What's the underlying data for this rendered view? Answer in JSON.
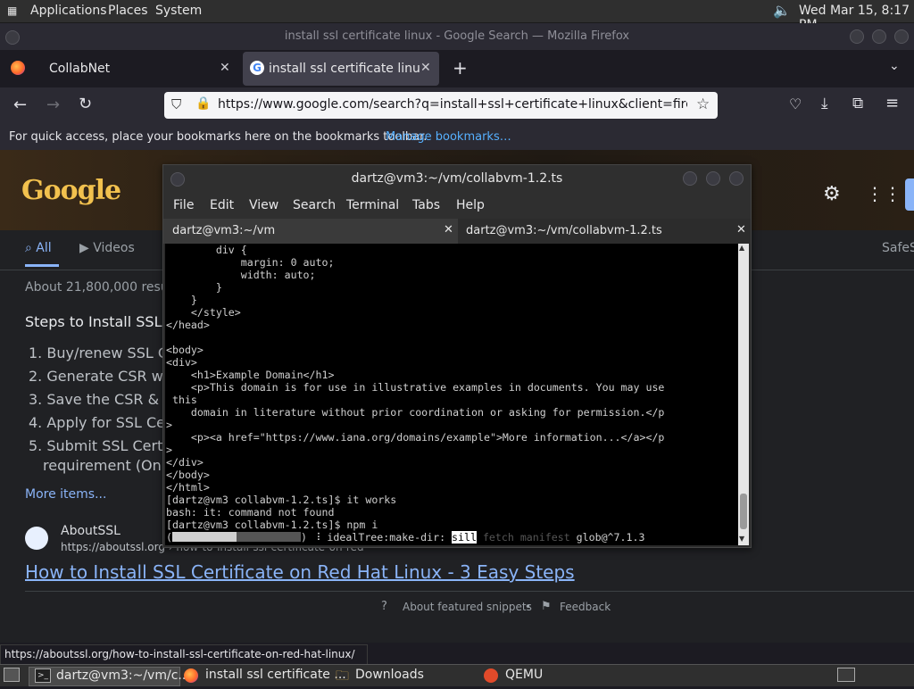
{
  "panel": {
    "applications": "Applications",
    "places": "Places",
    "system": "System",
    "clock": "Wed Mar 15,  8:17 PM"
  },
  "firefox": {
    "window_title": "install ssl certificate linux - Google Search — Mozilla Firefox",
    "tabs": [
      {
        "label": "CollabNet"
      },
      {
        "label": "install ssl certificate linux - Goo"
      }
    ],
    "url": "https://www.google.com/search?q=install+ssl+certificate+linux&client=firefox-b-1-d",
    "bookmarks_text": "For quick access, place your bookmarks here on the bookmarks toolbar.",
    "manage_bookmarks": "Manage bookmarks…"
  },
  "google": {
    "logo": "Google",
    "nav": {
      "all": "All",
      "videos": "Videos",
      "safesearch": "SafeS"
    },
    "result_stats": "About 21,800,000 results",
    "snippet_title": "Steps to Install SSL Certificate on Linux",
    "steps": [
      "1. Buy/renew SSL Certificate",
      "2. Generate CSR with",
      "3. Save the CSR & Private Key",
      "4. Apply for SSL Certificate",
      "5. Submit SSL Certificate",
      "requirement (Only for"
    ],
    "more_items": "More items...",
    "site_name": "AboutSSL",
    "site_url": "https://aboutssl.org › how-to-install-ssl-certificate-on-red-...",
    "result_link": "How to Install SSL Certificate on Red Hat Linux - 3 Easy Steps",
    "about_snippets": "About featured snippets",
    "feedback": "Feedback"
  },
  "terminal": {
    "title": "dartz@vm3:~/vm/collabvm-1.2.ts",
    "menu": [
      "File",
      "Edit",
      "View",
      "Search",
      "Terminal",
      "Tabs",
      "Help"
    ],
    "tabs": [
      {
        "label": "dartz@vm3:~/vm"
      },
      {
        "label": "dartz@vm3:~/vm/collabvm-1.2.ts"
      }
    ],
    "lines": [
      "        div {",
      "            margin: 0 auto;",
      "            width: auto;",
      "        }",
      "    }",
      "    </style>",
      "</head>",
      "",
      "<body>",
      "<div>",
      "    <h1>Example Domain</h1>",
      "    <p>This domain is for use in illustrative examples in documents. You may use",
      " this",
      "    domain in literature without prior coordination or asking for permission.</p",
      ">",
      "    <p><a href=\"https://www.iana.org/domains/example\">More information...</a></p",
      ">",
      "</div>",
      "</body>",
      "</html>",
      "[dartz@vm3 collabvm-1.2.ts]$ it works",
      "bash: it: command not found",
      "[dartz@vm3 collabvm-1.2.ts]$ npm i"
    ],
    "progress_pre": "(",
    "progress_mid": ") ",
    "progress_spinner": "⠸",
    "progress_stage": " idealTree:make-dir: ",
    "progress_sill": "sill",
    "progress_fetch": " fetch manifest ",
    "progress_pkg": "glob@^7.1.3"
  },
  "status_url": "https://aboutssl.org/how-to-install-ssl-certificate-on-red-hat-linux/",
  "taskbar": {
    "items": [
      {
        "label": "dartz@vm3:~/vm/c..."
      },
      {
        "label": "install ssl certificate ..."
      },
      {
        "label": "Downloads"
      },
      {
        "label": "QEMU"
      }
    ]
  }
}
